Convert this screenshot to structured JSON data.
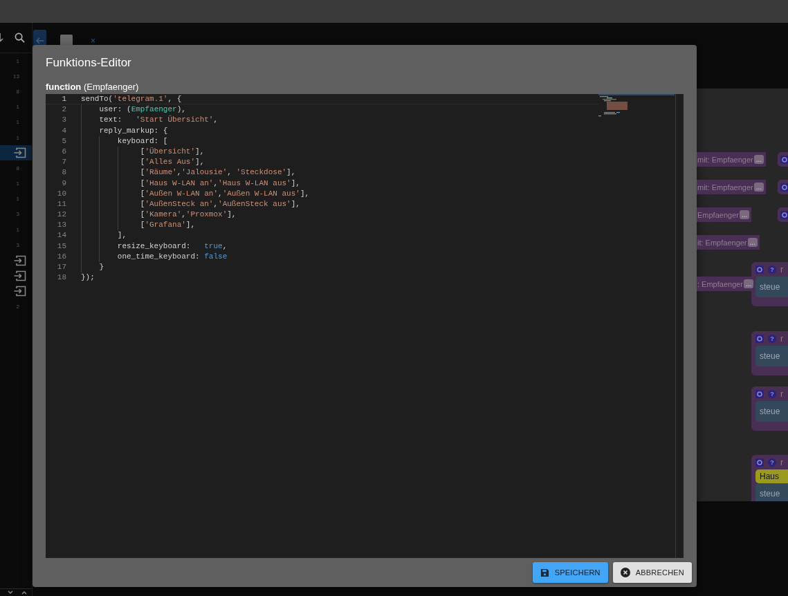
{
  "sidebar": {
    "items": [
      {
        "kind": "count",
        "text": "1",
        "selected": false
      },
      {
        "kind": "count",
        "text": "13",
        "selected": false
      },
      {
        "kind": "count",
        "text": "8",
        "selected": false
      },
      {
        "kind": "count",
        "text": "1",
        "selected": false
      },
      {
        "kind": "count",
        "text": "1",
        "selected": false
      },
      {
        "kind": "count",
        "text": "1",
        "selected": false
      },
      {
        "kind": "icon",
        "selected": true
      },
      {
        "kind": "count",
        "text": "8",
        "selected": false
      },
      {
        "kind": "count",
        "text": "1",
        "selected": false
      },
      {
        "kind": "count",
        "text": "1",
        "selected": false
      },
      {
        "kind": "count",
        "text": "3",
        "selected": false
      },
      {
        "kind": "count",
        "text": "1",
        "selected": false
      },
      {
        "kind": "count",
        "text": "3",
        "selected": false
      },
      {
        "kind": "icon",
        "selected": false
      },
      {
        "kind": "icon",
        "selected": false
      },
      {
        "kind": "icon",
        "selected": false
      },
      {
        "kind": "count",
        "text": "2",
        "selected": false
      }
    ]
  },
  "tab_bar": {
    "close": "×"
  },
  "canvas": {
    "blocks": [
      {
        "kind": "param",
        "text": "mit: Empfaenger",
        "more": "..."
      },
      {
        "kind": "param",
        "text": "mit: Empfaenger",
        "more": "..."
      },
      {
        "kind": "param",
        "text": "Empfaenger",
        "more": "..."
      },
      {
        "kind": "param",
        "text": "it: Empfaenger",
        "more": "..."
      },
      {
        "kind": "param",
        "text": ": Empfaenger",
        "more": "..."
      },
      {
        "kind": "stub"
      },
      {
        "kind": "stub"
      },
      {
        "kind": "stub"
      },
      {
        "kind": "function",
        "help": "?",
        "title": "r",
        "body": "steue"
      },
      {
        "kind": "function",
        "help": "?",
        "title": "r",
        "body": "steue"
      },
      {
        "kind": "function",
        "help": "?",
        "title": "r",
        "body": "steue"
      },
      {
        "kind": "function",
        "help": "?",
        "title": "r",
        "label": "Haus",
        "body": "steue"
      }
    ]
  },
  "dialog": {
    "title": "Funktions-Editor",
    "subtitle": "**function** (Empfaenger)",
    "code": [
      {
        "number": "1",
        "tokens": [
          {
            "kind": "plain",
            "text": "sendTo("
          },
          {
            "kind": "string",
            "text": "'telegram.1'"
          },
          {
            "kind": "plain",
            "text": ", {"
          }
        ]
      },
      {
        "number": "2",
        "tokens": [
          {
            "kind": "plain",
            "text": "    user: ("
          },
          {
            "kind": "variable",
            "text": "Empfaenger"
          },
          {
            "kind": "plain",
            "text": "),"
          }
        ]
      },
      {
        "number": "3",
        "tokens": [
          {
            "kind": "plain",
            "text": "    text:   "
          },
          {
            "kind": "string",
            "text": "'Start Übersicht'"
          },
          {
            "kind": "plain",
            "text": ","
          }
        ]
      },
      {
        "number": "4",
        "tokens": [
          {
            "kind": "plain",
            "text": "    reply_markup: {"
          }
        ]
      },
      {
        "number": "5",
        "tokens": [
          {
            "kind": "plain",
            "text": "        keyboard: ["
          }
        ]
      },
      {
        "number": "6",
        "tokens": [
          {
            "kind": "plain",
            "text": "             ["
          },
          {
            "kind": "string",
            "text": "'Übersicht'"
          },
          {
            "kind": "plain",
            "text": "],"
          }
        ]
      },
      {
        "number": "7",
        "tokens": [
          {
            "kind": "plain",
            "text": "             ["
          },
          {
            "kind": "string",
            "text": "'Alles Aus'"
          },
          {
            "kind": "plain",
            "text": "],"
          }
        ]
      },
      {
        "number": "8",
        "tokens": [
          {
            "kind": "plain",
            "text": "             ["
          },
          {
            "kind": "string",
            "text": "'Räume'"
          },
          {
            "kind": "plain",
            "text": ","
          },
          {
            "kind": "string",
            "text": "'Jalousie'"
          },
          {
            "kind": "plain",
            "text": ", "
          },
          {
            "kind": "string",
            "text": "'Steckdose'"
          },
          {
            "kind": "plain",
            "text": "],"
          }
        ]
      },
      {
        "number": "9",
        "tokens": [
          {
            "kind": "plain",
            "text": "             ["
          },
          {
            "kind": "string",
            "text": "'Haus W-LAN an'"
          },
          {
            "kind": "plain",
            "text": ","
          },
          {
            "kind": "string",
            "text": "'Haus W-LAN aus'"
          },
          {
            "kind": "plain",
            "text": "],"
          }
        ]
      },
      {
        "number": "10",
        "tokens": [
          {
            "kind": "plain",
            "text": "             ["
          },
          {
            "kind": "string",
            "text": "'Außen W-LAN an'"
          },
          {
            "kind": "plain",
            "text": ","
          },
          {
            "kind": "string",
            "text": "'Außen W-LAN aus'"
          },
          {
            "kind": "plain",
            "text": "],"
          }
        ]
      },
      {
        "number": "11",
        "tokens": [
          {
            "kind": "plain",
            "text": "             ["
          },
          {
            "kind": "string",
            "text": "'AußenSteck an'"
          },
          {
            "kind": "plain",
            "text": ","
          },
          {
            "kind": "string",
            "text": "'AußenSteck aus'"
          },
          {
            "kind": "plain",
            "text": "],"
          }
        ]
      },
      {
        "number": "12",
        "tokens": [
          {
            "kind": "plain",
            "text": "             ["
          },
          {
            "kind": "string",
            "text": "'Kamera'"
          },
          {
            "kind": "plain",
            "text": ","
          },
          {
            "kind": "string",
            "text": "'Proxmox'"
          },
          {
            "kind": "plain",
            "text": "],"
          }
        ]
      },
      {
        "number": "13",
        "tokens": [
          {
            "kind": "plain",
            "text": "             ["
          },
          {
            "kind": "string",
            "text": "'Grafana'"
          },
          {
            "kind": "plain",
            "text": "],"
          }
        ]
      },
      {
        "number": "14",
        "tokens": [
          {
            "kind": "plain",
            "text": "        ],"
          }
        ]
      },
      {
        "number": "15",
        "tokens": [
          {
            "kind": "plain",
            "text": "        resize_keyboard:   "
          },
          {
            "kind": "keyword",
            "text": "true"
          },
          {
            "kind": "plain",
            "text": ","
          }
        ]
      },
      {
        "number": "16",
        "tokens": [
          {
            "kind": "plain",
            "text": "        one_time_keyboard: "
          },
          {
            "kind": "keyword",
            "text": "false"
          }
        ]
      },
      {
        "number": "17",
        "tokens": [
          {
            "kind": "plain",
            "text": "    }"
          }
        ]
      },
      {
        "number": "18",
        "tokens": [
          {
            "kind": "plain",
            "text": "});"
          }
        ]
      }
    ],
    "buttons": [
      {
        "kind": "save",
        "label": "SPEICHERN"
      },
      {
        "kind": "cancel",
        "label": "ABBRECHEN"
      }
    ]
  }
}
